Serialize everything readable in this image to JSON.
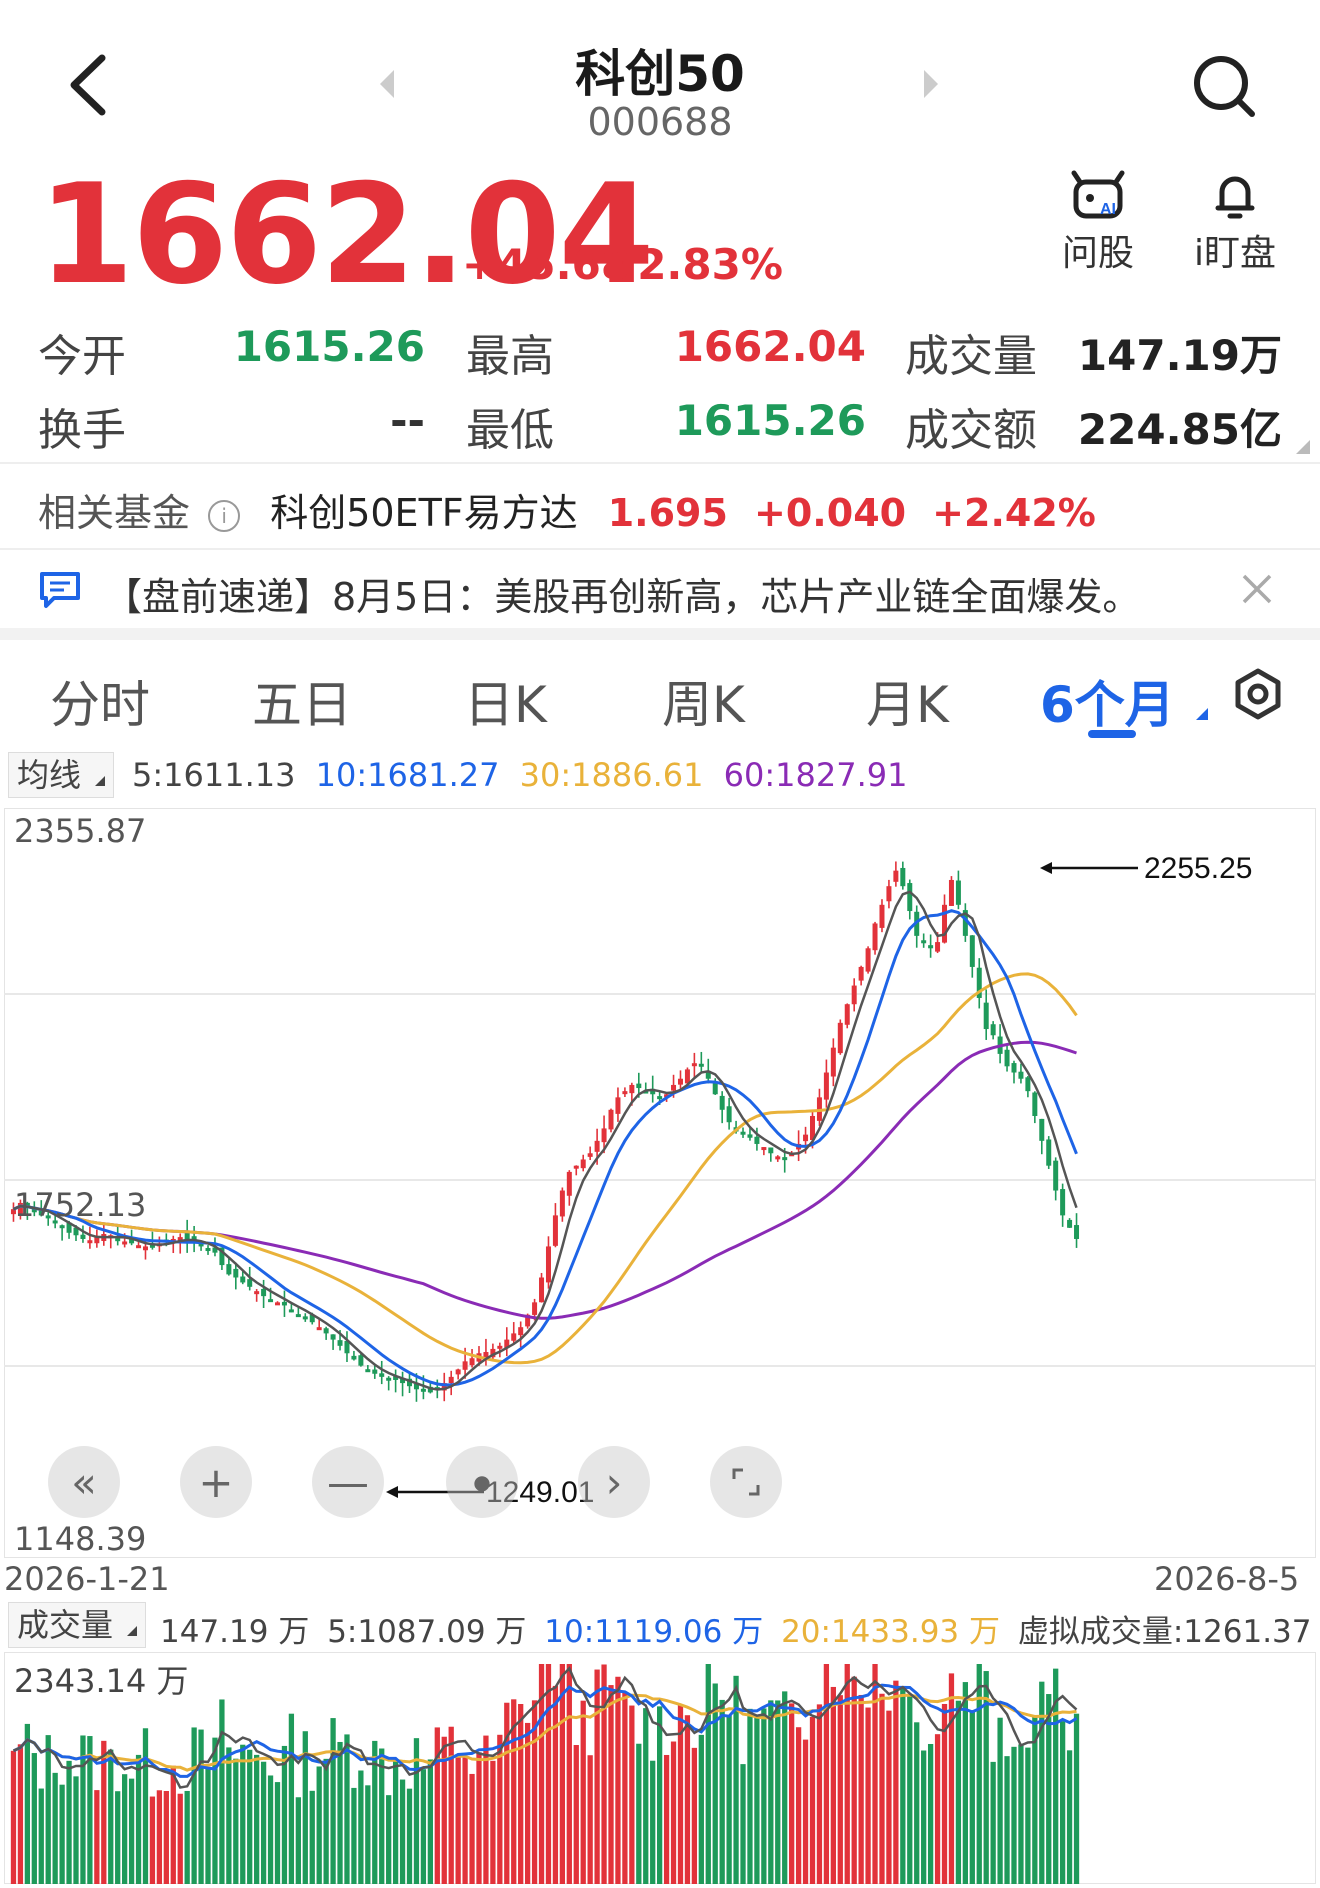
{
  "header": {
    "title": "科创50",
    "code": "000688"
  },
  "quote": {
    "price": "1662.04",
    "change": "+45.68",
    "change_pct": "+2.83%"
  },
  "actions": [
    {
      "label": "问股",
      "icon": "ai-robot-icon"
    },
    {
      "label": "i盯盘",
      "icon": "bell-icon"
    }
  ],
  "stats": {
    "open_label": "今开",
    "open": "1615.26",
    "high_label": "最高",
    "high": "1662.04",
    "volume_label": "成交量",
    "volume": "147.19万",
    "turnover_label": "换手",
    "turnover": "--",
    "low_label": "最低",
    "low": "1615.26",
    "amount_label": "成交额",
    "amount": "224.85亿"
  },
  "fund": {
    "label": "相关基金",
    "name": "科创50ETF易方达",
    "price": "1.695",
    "change": "+0.040",
    "change_pct": "+2.42%"
  },
  "news": {
    "text": "【盘前速递】8月5日：美股再创新高，芯片产业链全面爆发。"
  },
  "tabs": [
    {
      "label": "分时"
    },
    {
      "label": "五日"
    },
    {
      "label": "日K"
    },
    {
      "label": "周K"
    },
    {
      "label": "月K"
    },
    {
      "label": "6个月",
      "active": true
    }
  ],
  "ma_legend": {
    "pill": "均线",
    "ma5": "5:1611.13",
    "ma10": "10:1681.27",
    "ma30": "30:1886.61",
    "ma60": "60:1827.91"
  },
  "price_axis": {
    "top": "2355.87",
    "mid": "1752.13",
    "bottom": "1148.39",
    "max_mark": "2255.25",
    "min_mark": "1249.01"
  },
  "date_axis": {
    "start": "2026-1-21",
    "end": "2026-8-5"
  },
  "volume_legend": {
    "pill": "成交量",
    "current": "147.19 万",
    "ma5": "5:1087.09 万",
    "ma10": "10:1119.06 万",
    "ma20": "20:1433.93 万",
    "virtual": "虚拟成交量:1261.37 万",
    "top": "2343.14 万"
  },
  "colors": {
    "up": "#e2323a",
    "down": "#1e9a5a",
    "ma5": "#555555",
    "ma10": "#1e64e6",
    "ma30": "#e9b23a",
    "ma60": "#8a2bb5",
    "active_tab": "#1e64e6"
  },
  "chart_data": {
    "type": "candlestick",
    "title": "",
    "x_range": [
      "2026-1-21",
      "2026-8-5"
    ],
    "ylim": [
      1148.39,
      2355.87
    ],
    "price_series": [
      1710,
      1720,
      1712,
      1705,
      1700,
      1698,
      1690,
      1680,
      1672,
      1668,
      1662,
      1660,
      1665,
      1670,
      1668,
      1662,
      1658,
      1655,
      1652,
      1650,
      1652,
      1655,
      1660,
      1662,
      1665,
      1660,
      1655,
      1650,
      1645,
      1640,
      1620,
      1605,
      1600,
      1592,
      1585,
      1578,
      1570,
      1565,
      1560,
      1555,
      1545,
      1540,
      1535,
      1528,
      1520,
      1510,
      1500,
      1490,
      1478,
      1468,
      1458,
      1450,
      1445,
      1440,
      1438,
      1435,
      1430,
      1425,
      1420,
      1418,
      1415,
      1420,
      1430,
      1440,
      1452,
      1465,
      1470,
      1478,
      1480,
      1485,
      1490,
      1500,
      1510,
      1520,
      1540,
      1560,
      1600,
      1650,
      1700,
      1740,
      1770,
      1780,
      1790,
      1800,
      1820,
      1840,
      1870,
      1890,
      1900,
      1910,
      1905,
      1900,
      1895,
      1890,
      1895,
      1910,
      1920,
      1935,
      1945,
      1940,
      1920,
      1895,
      1870,
      1850,
      1835,
      1830,
      1825,
      1815,
      1810,
      1800,
      1795,
      1790,
      1800,
      1815,
      1830,
      1860,
      1890,
      1930,
      1970,
      2010,
      2040,
      2070,
      2100,
      2130,
      2170,
      2200,
      2230,
      2255,
      2230,
      2190,
      2150,
      2140,
      2130,
      2140,
      2200,
      2240,
      2200,
      2150,
      2100,
      2050,
      2000,
      1990,
      1960,
      1940,
      1930,
      1920,
      1900,
      1860,
      1820,
      1780,
      1740,
      1700,
      1680,
      1662
    ],
    "ma5": "line series (gray)",
    "ma10": "line series (blue)",
    "ma30": "line series (orange)",
    "ma60": "line series (purple)",
    "annotations": [
      {
        "label": "2255.25",
        "type": "high"
      },
      {
        "label": "1249.01",
        "type": "low"
      }
    ],
    "volume_max": "2343.14 万"
  }
}
